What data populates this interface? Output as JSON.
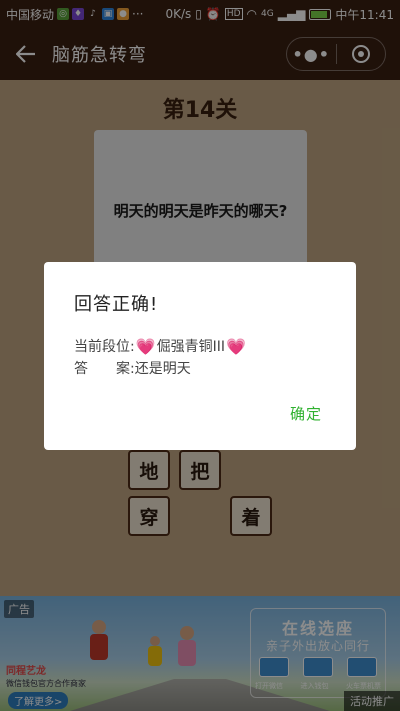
{
  "status_bar": {
    "carrier": "中国移动",
    "speed": "0K/s",
    "network": "4G",
    "time": "中午11:41",
    "battery_level": 0.85
  },
  "nav": {
    "title": "脑筋急转弯"
  },
  "game": {
    "level": "第14关",
    "question": "明天的明天是昨天的哪天?",
    "tiles": [
      "地",
      "把",
      "穿",
      "着"
    ]
  },
  "modal": {
    "title": "回答正确!",
    "rank_label": "当前段位:",
    "rank_value": "倔强青铜III",
    "answer_label": "答　　案:",
    "answer_value": "还是明天",
    "confirm_label": "确定"
  },
  "ad": {
    "tag": "广告",
    "brand_name": "同程艺龙",
    "brand_slogan": "微信钱包官方合作商家",
    "more_button": "了解更多>",
    "headline": "在线选座",
    "subline": "亲子外出放心同行",
    "step_labels": [
      "打开微信",
      "进入钱包",
      "火车票机票"
    ],
    "promo_label": "活动推广"
  },
  "colors": {
    "nav_bg": "#3a1f12",
    "game_bg": "#bfa581",
    "tile_border": "#4e2b17",
    "confirm_green": "#2fb12f",
    "heart_pink": "#ff7fb0"
  }
}
